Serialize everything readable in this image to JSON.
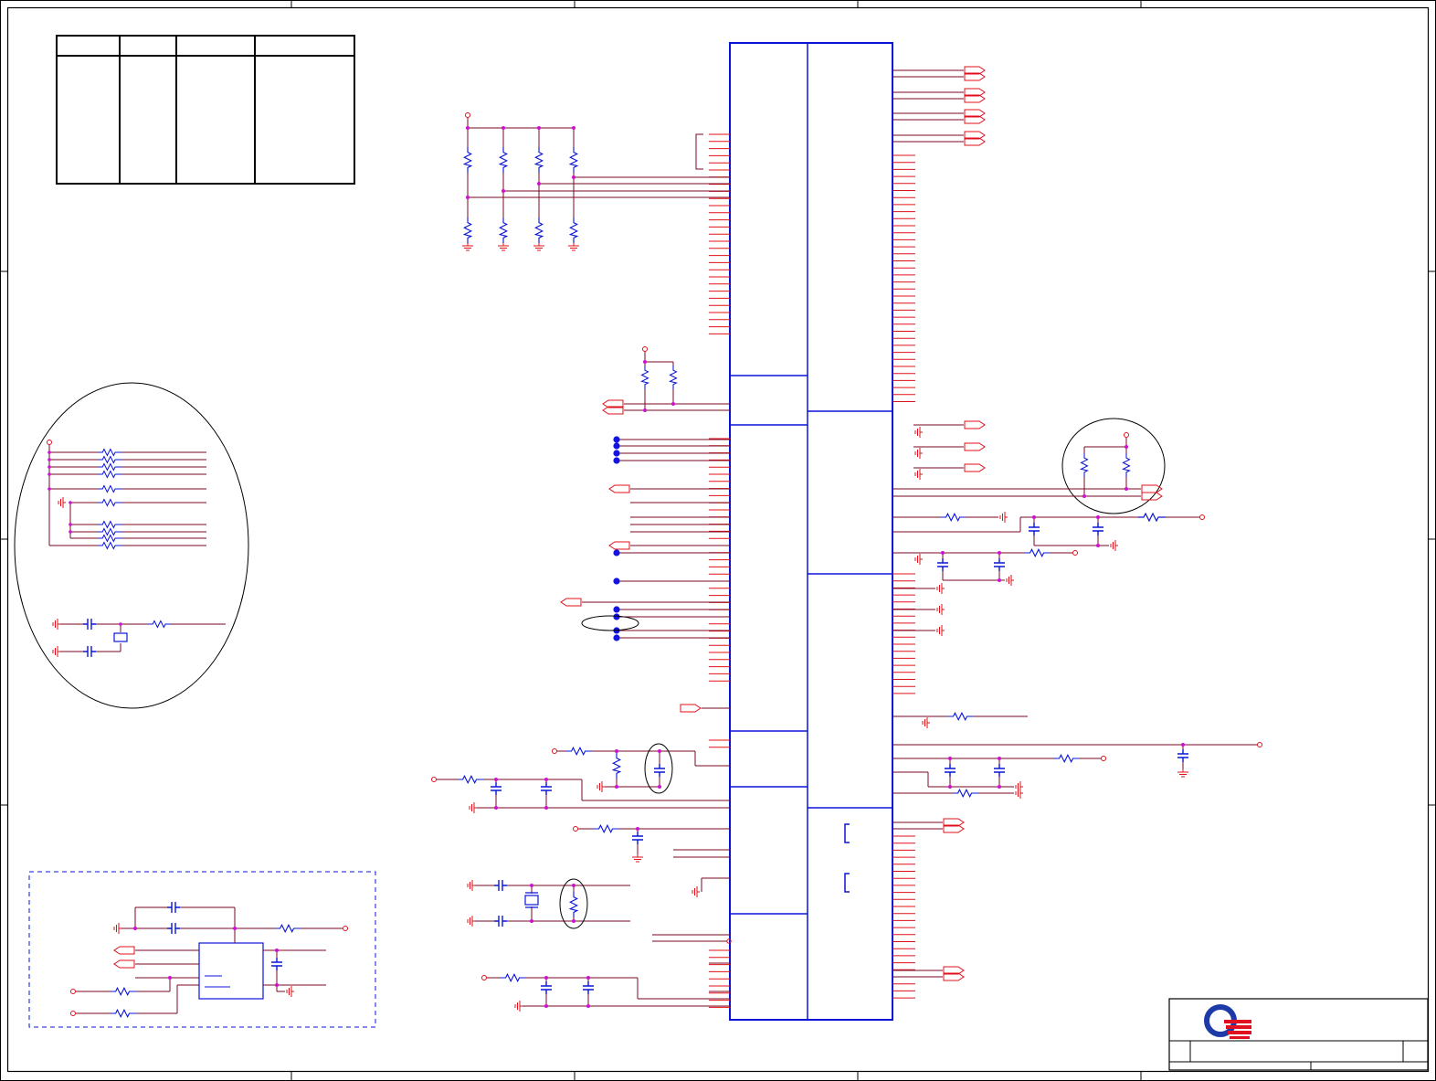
{
  "sheet": {
    "zone_marks_top": [
      "",
      "",
      "",
      "",
      ""
    ],
    "zone_marks_side": [
      "",
      "",
      ""
    ]
  },
  "revision_table": {
    "columns": [
      "",
      "",
      "",
      ""
    ],
    "rows": []
  },
  "title_block": {
    "logo": "quanta-logo",
    "title": "",
    "size": "",
    "document_number": "",
    "rev": "",
    "sheet": ""
  },
  "colors": {
    "frame": "#000000",
    "component": "#0a14d8",
    "wire": "#7a0a22",
    "pin": "#e0101a",
    "junction": "#d010d0",
    "node": "#1414e0",
    "connector": "#e0101a"
  },
  "icons": [
    "resistor-icon",
    "capacitor-icon",
    "ground-icon",
    "crystal-icon",
    "offpage-connector-icon",
    "power-port-icon",
    "junction-dot-icon"
  ]
}
